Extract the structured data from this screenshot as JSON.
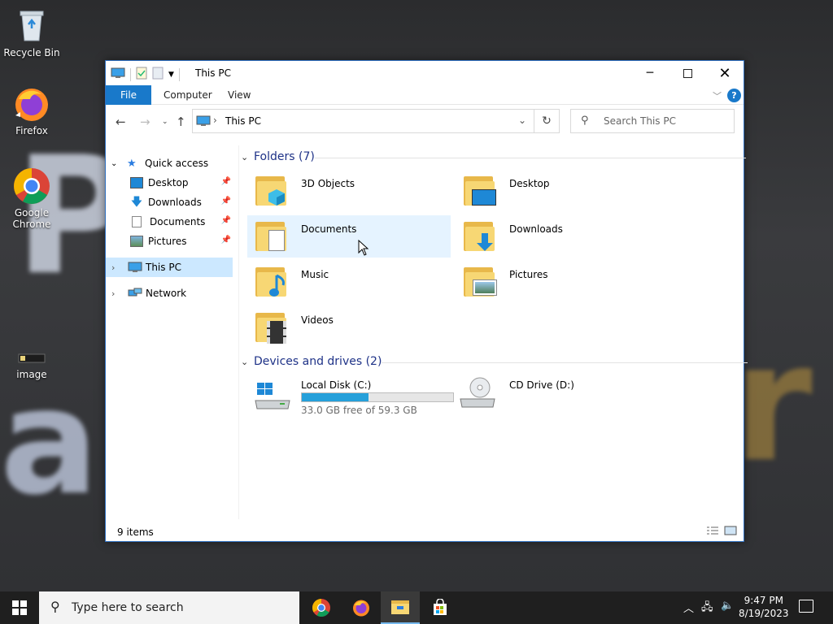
{
  "desktop": {
    "icons": [
      {
        "label": "Recycle Bin",
        "icon": "recycle-bin-icon"
      },
      {
        "label": "Firefox",
        "icon": "firefox-icon"
      },
      {
        "label": "Google Chrome",
        "icon": "chrome-icon"
      },
      {
        "label": "image",
        "icon": "image-file-icon"
      }
    ]
  },
  "window": {
    "title": "This PC",
    "ribbon_tabs": [
      "File",
      "Computer",
      "View"
    ],
    "address": "This PC",
    "search_placeholder": "Search This PC",
    "nav": {
      "quick_access": "Quick access",
      "quick_items": [
        "Desktop",
        "Downloads",
        "Documents",
        "Pictures"
      ],
      "this_pc": "This PC",
      "network": "Network"
    },
    "folders_header": "Folders (7)",
    "folders": [
      {
        "name": "3D Objects",
        "icon": "3d-objects-folder-icon"
      },
      {
        "name": "Desktop",
        "icon": "desktop-folder-icon"
      },
      {
        "name": "Documents",
        "icon": "documents-folder-icon"
      },
      {
        "name": "Downloads",
        "icon": "downloads-folder-icon"
      },
      {
        "name": "Music",
        "icon": "music-folder-icon"
      },
      {
        "name": "Pictures",
        "icon": "pictures-folder-icon"
      },
      {
        "name": "Videos",
        "icon": "videos-folder-icon"
      }
    ],
    "devices_header": "Devices and drives (2)",
    "drives": [
      {
        "name": "Local Disk (C:)",
        "free_text": "33.0 GB free of 59.3 GB",
        "used_fraction": 0.44
      },
      {
        "name": "CD Drive (D:)"
      }
    ],
    "status": "9 items"
  },
  "taskbar": {
    "search_placeholder": "Type here to search",
    "time": "9:47 PM",
    "date": "8/19/2023"
  },
  "colors": {
    "accent": "#1979ca",
    "selection": "#cce8ff",
    "hover": "#e5f3ff",
    "drive_fill": "#26a0da"
  }
}
